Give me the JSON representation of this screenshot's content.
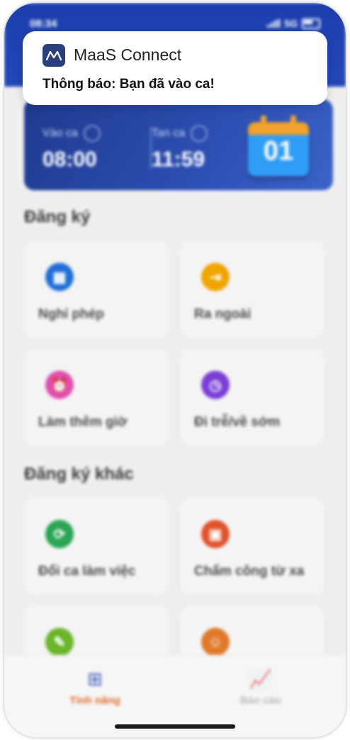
{
  "status_bar": {
    "time": "08:34",
    "network": "5G"
  },
  "notification": {
    "app_name": "MaaS Connect",
    "message": "Thông báo: Bạn đã vào ca!"
  },
  "shift": {
    "check_in_label": "Vào ca",
    "check_in_time": "08:00",
    "check_out_label": "Tan ca",
    "check_out_time": "11:59",
    "calendar_day": "01"
  },
  "register": {
    "title": "Đăng ký",
    "items": [
      {
        "label": "Nghỉ phép",
        "icon": "calendar-icon",
        "color": "#1f6fd6"
      },
      {
        "label": "Ra ngoài",
        "icon": "exit-door-icon",
        "color": "#f0a400"
      },
      {
        "label": "Làm thêm giờ",
        "icon": "alarm-clock-icon",
        "color": "#e04fb0"
      },
      {
        "label": "Đi trễ/về sớm",
        "icon": "clock-icon",
        "color": "#7b3fd6"
      }
    ]
  },
  "other_register": {
    "title": "Đăng ký khác",
    "items": [
      {
        "label": "Đổi ca làm việc",
        "icon": "swap-icon",
        "color": "#2aa553"
      },
      {
        "label": "Chấm công từ xa",
        "icon": "remote-checkin-icon",
        "color": "#e0532a"
      },
      {
        "label": "",
        "icon": "checklist-icon",
        "color": "#6bb52a"
      },
      {
        "label": "",
        "icon": "user-icon",
        "color": "#e07a2a"
      }
    ]
  },
  "bottom_nav": {
    "items": [
      {
        "label": "Tính năng",
        "icon": "grid-icon",
        "active": true,
        "color": "#e06a2a"
      },
      {
        "label": "Báo cáo",
        "icon": "chart-icon",
        "active": false,
        "color": "#b8b8b8"
      }
    ]
  }
}
